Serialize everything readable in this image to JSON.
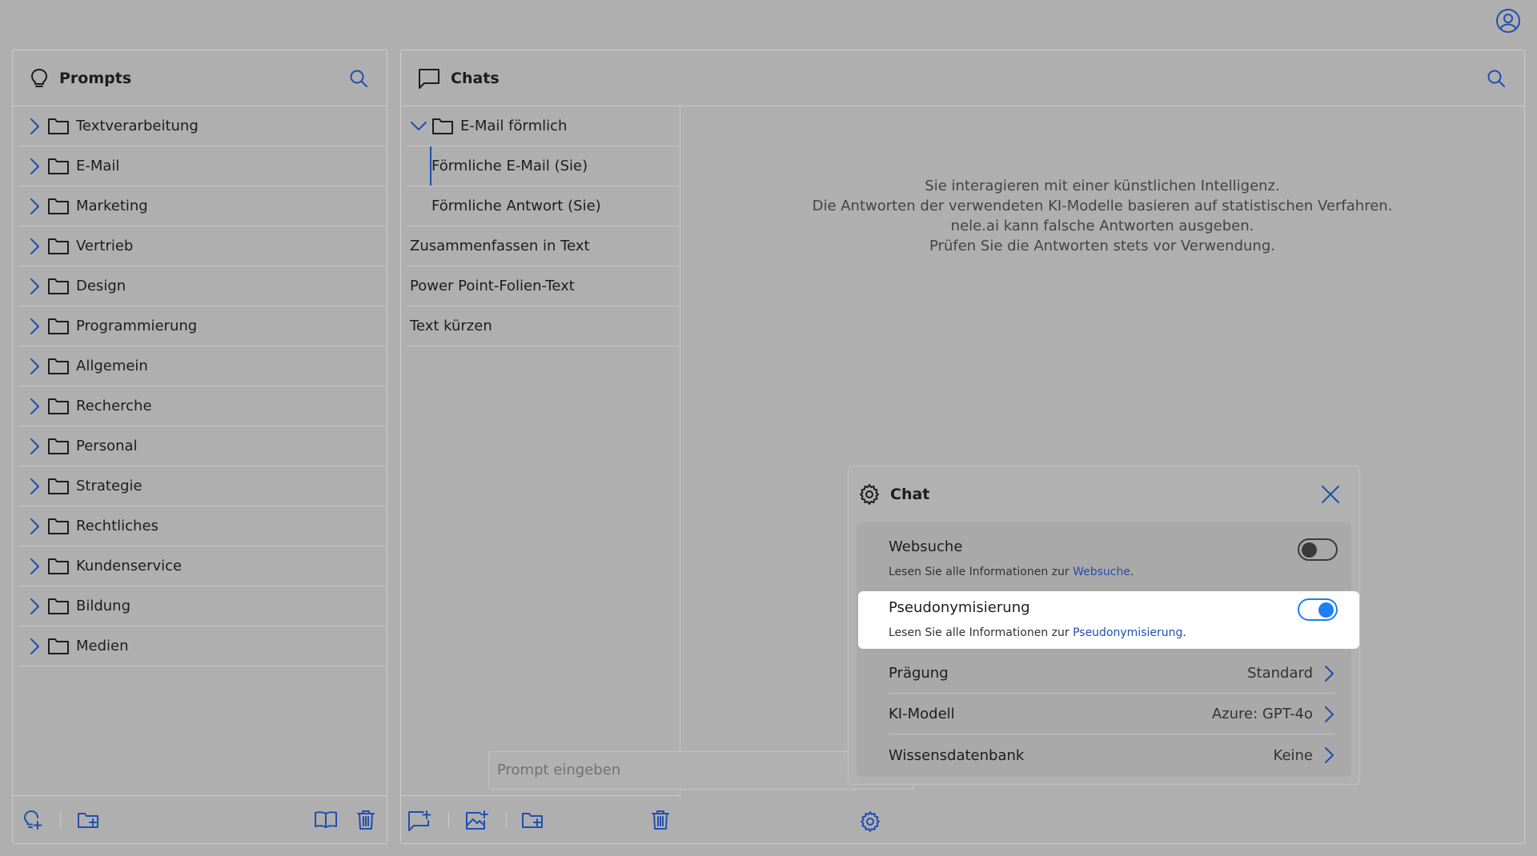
{
  "prompts_panel": {
    "title": "Prompts",
    "folders": [
      {
        "label": "Textverarbeitung"
      },
      {
        "label": "E-Mail"
      },
      {
        "label": "Marketing"
      },
      {
        "label": "Vertrieb"
      },
      {
        "label": "Design"
      },
      {
        "label": "Programmierung"
      },
      {
        "label": "Allgemein"
      },
      {
        "label": "Recherche"
      },
      {
        "label": "Personal"
      },
      {
        "label": "Strategie"
      },
      {
        "label": "Rechtliches"
      },
      {
        "label": "Kundenservice"
      },
      {
        "label": "Bildung"
      },
      {
        "label": "Medien"
      }
    ],
    "footer_icons": [
      "new-prompt-icon",
      "new-folder-icon",
      "library-icon",
      "trash-icon"
    ]
  },
  "chats_panel": {
    "title": "Chats",
    "open_folder": "E-Mail förmlich",
    "folder_items": [
      "Förmliche E-Mail (Sie)",
      "Förmliche Antwort (Sie)"
    ],
    "chats": [
      "Zusammenfassen in Text",
      "Power Point-Folien-Text",
      "Text kürzen"
    ],
    "footer_icons": [
      "new-chat-icon",
      "new-image-chat-icon",
      "new-folder-icon",
      "trash-icon"
    ]
  },
  "notice": {
    "line1": "Sie interagieren mit einer künstlichen Intelligenz.",
    "line2": "Die Antworten der verwendeten KI-Modelle basieren auf statistischen Verfahren.",
    "line3": "nele.ai kann falsche Antworten ausgeben.",
    "line4": "Prüfen Sie die Antworten stets vor Verwendung."
  },
  "chat_settings": {
    "title": "Chat",
    "websuche": {
      "label": "Websuche",
      "desc_prefix": "Lesen Sie alle Informationen zur ",
      "link": "Websuche",
      "suffix": ".",
      "enabled": false
    },
    "pseudonymisierung": {
      "label": "Pseudonymisierung",
      "desc_prefix": "Lesen Sie alle Informationen zur ",
      "link": "Pseudonymisierung",
      "suffix": ".",
      "enabled": true
    },
    "praegung": {
      "label": "Prägung",
      "value": "Standard"
    },
    "ki_modell": {
      "label": "KI-Modell",
      "value": "Azure: GPT-4o"
    },
    "wissensdatenbank": {
      "label": "Wissensdatenbank",
      "value": "Keine"
    },
    "accent_color": "#1e7ef5",
    "link_color": "#1f4fae"
  },
  "prompt_input": {
    "placeholder": "Prompt eingeben",
    "value": ""
  }
}
